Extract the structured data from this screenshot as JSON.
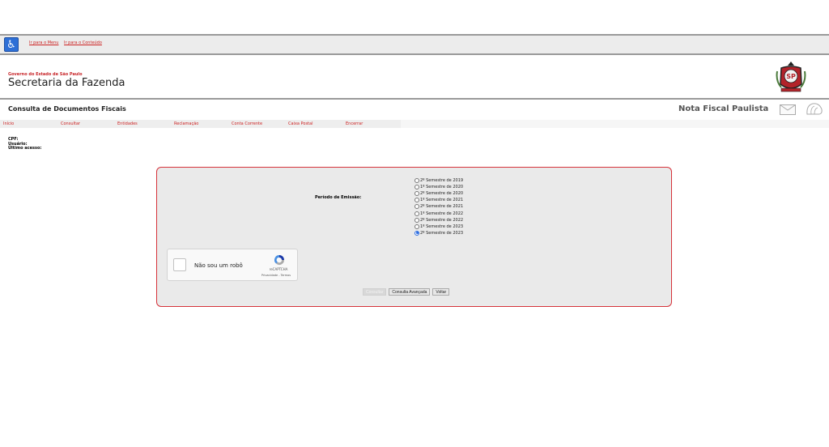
{
  "accessibility": {
    "icon": "wheelchair-icon",
    "links": [
      "Ir para o Menu",
      "Ir para o Conteúdo"
    ]
  },
  "header": {
    "gov_label": "Governo do Estado de São Paulo",
    "secretaria": "Secretaria da Fazenda",
    "seal_text": "SP"
  },
  "titlebar": {
    "page_title": "Consulta de Documentos Fiscais",
    "product": "Nota Fiscal Paulista"
  },
  "nav": {
    "items": [
      "Início",
      "Consultar",
      "Entidades",
      "Reclamação",
      "Conta Corrente",
      "Caixa Postal",
      "Encerrar"
    ]
  },
  "user": {
    "cpf_label": "CPF:",
    "usuario_label": "Usuário:",
    "ultimo_label": "Último acesso:"
  },
  "form": {
    "period_label": "Período de Emissão:",
    "periods": [
      "2º Semestre de 2019",
      "1º Semestre de 2020",
      "2º Semestre de 2020",
      "1º Semestre de 2021",
      "2º Semestre de 2021",
      "1º Semestre de 2022",
      "2º Semestre de 2022",
      "1º Semestre de 2023",
      "2º Semestre de 2023"
    ],
    "selected_period": "2º Semestre de 2023",
    "captcha": {
      "label": "Não sou um robô",
      "brand": "reCAPTCHA",
      "links": "Privacidade - Termos"
    },
    "buttons": {
      "consultar": "Consultar",
      "avancada": "Consulta Avançada",
      "voltar": "Voltar"
    }
  },
  "colors": {
    "accent_red": "#d6323a",
    "link_red": "#c22",
    "radio_blue": "#2a6be0"
  }
}
